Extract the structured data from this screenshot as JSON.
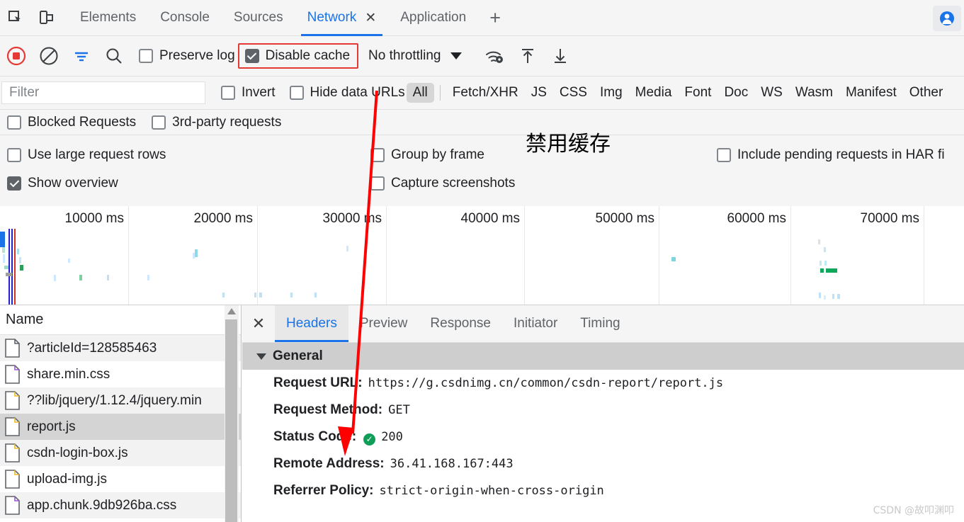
{
  "tabbar": {
    "inspect_icon": "inspect-element-icon",
    "device_icon": "device-toolbar-icon",
    "tabs": [
      {
        "label": "Elements",
        "active": false
      },
      {
        "label": "Console",
        "active": false
      },
      {
        "label": "Sources",
        "active": false
      },
      {
        "label": "Network",
        "active": true
      },
      {
        "label": "Application",
        "active": false
      }
    ],
    "close_label": "✕",
    "add_label": "+",
    "avatar_icon": "profile-avatar-icon"
  },
  "toolbar": {
    "record_icon": "record-stop-icon",
    "clear_icon": "clear-network-log-icon",
    "filter_icon": "filter-toggle-icon",
    "search_icon": "search-icon",
    "preserve_log": {
      "label": "Preserve log",
      "checked": false
    },
    "disable_cache": {
      "label": "Disable cache",
      "checked": true
    },
    "throttling": {
      "value": "No throttling"
    },
    "network_conditions_icon": "wifi-gear-icon",
    "import_icon": "import-har-icon",
    "export_icon": "export-har-icon"
  },
  "filterbar": {
    "placeholder": "Filter",
    "value": "",
    "invert": {
      "label": "Invert",
      "checked": false
    },
    "hide_data_urls": {
      "label": "Hide data URLs",
      "checked": false
    },
    "types": [
      {
        "label": "All",
        "selected": true
      },
      {
        "label": "Fetch/XHR",
        "selected": false
      },
      {
        "label": "JS",
        "selected": false
      },
      {
        "label": "CSS",
        "selected": false
      },
      {
        "label": "Img",
        "selected": false
      },
      {
        "label": "Media",
        "selected": false
      },
      {
        "label": "Font",
        "selected": false
      },
      {
        "label": "Doc",
        "selected": false
      },
      {
        "label": "WS",
        "selected": false
      },
      {
        "label": "Wasm",
        "selected": false
      },
      {
        "label": "Manifest",
        "selected": false
      },
      {
        "label": "Other",
        "selected": false
      }
    ]
  },
  "settings": {
    "blocked_requests": {
      "label": "Blocked Requests",
      "checked": false
    },
    "third_party": {
      "label": "3rd-party requests",
      "checked": false
    },
    "large_rows": {
      "label": "Use large request rows",
      "checked": false
    },
    "show_overview": {
      "label": "Show overview",
      "checked": true
    },
    "group_by_frame": {
      "label": "Group by frame",
      "checked": false
    },
    "capture_screenshots": {
      "label": "Capture screenshots",
      "checked": false
    },
    "include_pending": {
      "label": "Include pending requests in HAR fi",
      "checked": false
    }
  },
  "overview": {
    "ticks": [
      "10000 ms",
      "20000 ms",
      "30000 ms",
      "40000 ms",
      "50000 ms",
      "60000 ms",
      "70000 ms"
    ]
  },
  "requests": {
    "column_header": "Name",
    "rows": [
      {
        "name": "?articleId=128585463",
        "type": "doc",
        "selected": false
      },
      {
        "name": "share.min.css",
        "type": "css",
        "selected": false
      },
      {
        "name": "??lib/jquery/1.12.4/jquery.min",
        "type": "js",
        "selected": false
      },
      {
        "name": "report.js",
        "type": "js",
        "selected": true
      },
      {
        "name": "csdn-login-box.js",
        "type": "js",
        "selected": false
      },
      {
        "name": "upload-img.js",
        "type": "js",
        "selected": false
      },
      {
        "name": "app.chunk.9db926ba.css",
        "type": "css",
        "selected": false
      }
    ]
  },
  "detail": {
    "close_label": "✕",
    "tabs": [
      {
        "label": "Headers",
        "active": true
      },
      {
        "label": "Preview",
        "active": false
      },
      {
        "label": "Response",
        "active": false
      },
      {
        "label": "Initiator",
        "active": false
      },
      {
        "label": "Timing",
        "active": false
      }
    ],
    "section_title": "General",
    "headers": [
      {
        "key": "Request URL:",
        "value": "https://g.csdnimg.cn/common/csdn-report/report.js",
        "badge": false
      },
      {
        "key": "Request Method:",
        "value": "GET",
        "badge": false
      },
      {
        "key": "Status Code:",
        "value": "200",
        "badge": true
      },
      {
        "key": "Remote Address:",
        "value": "36.41.168.167:443",
        "badge": false
      },
      {
        "key": "Referrer Policy:",
        "value": "strict-origin-when-cross-origin",
        "badge": false
      }
    ],
    "status_ok_glyph": "✓"
  },
  "annotations": {
    "chinese_note": "禁用缓存",
    "arrow_color": "#ff0000",
    "highlight_color": "#e53935",
    "watermark": "CSDN @故叩渊叩"
  }
}
